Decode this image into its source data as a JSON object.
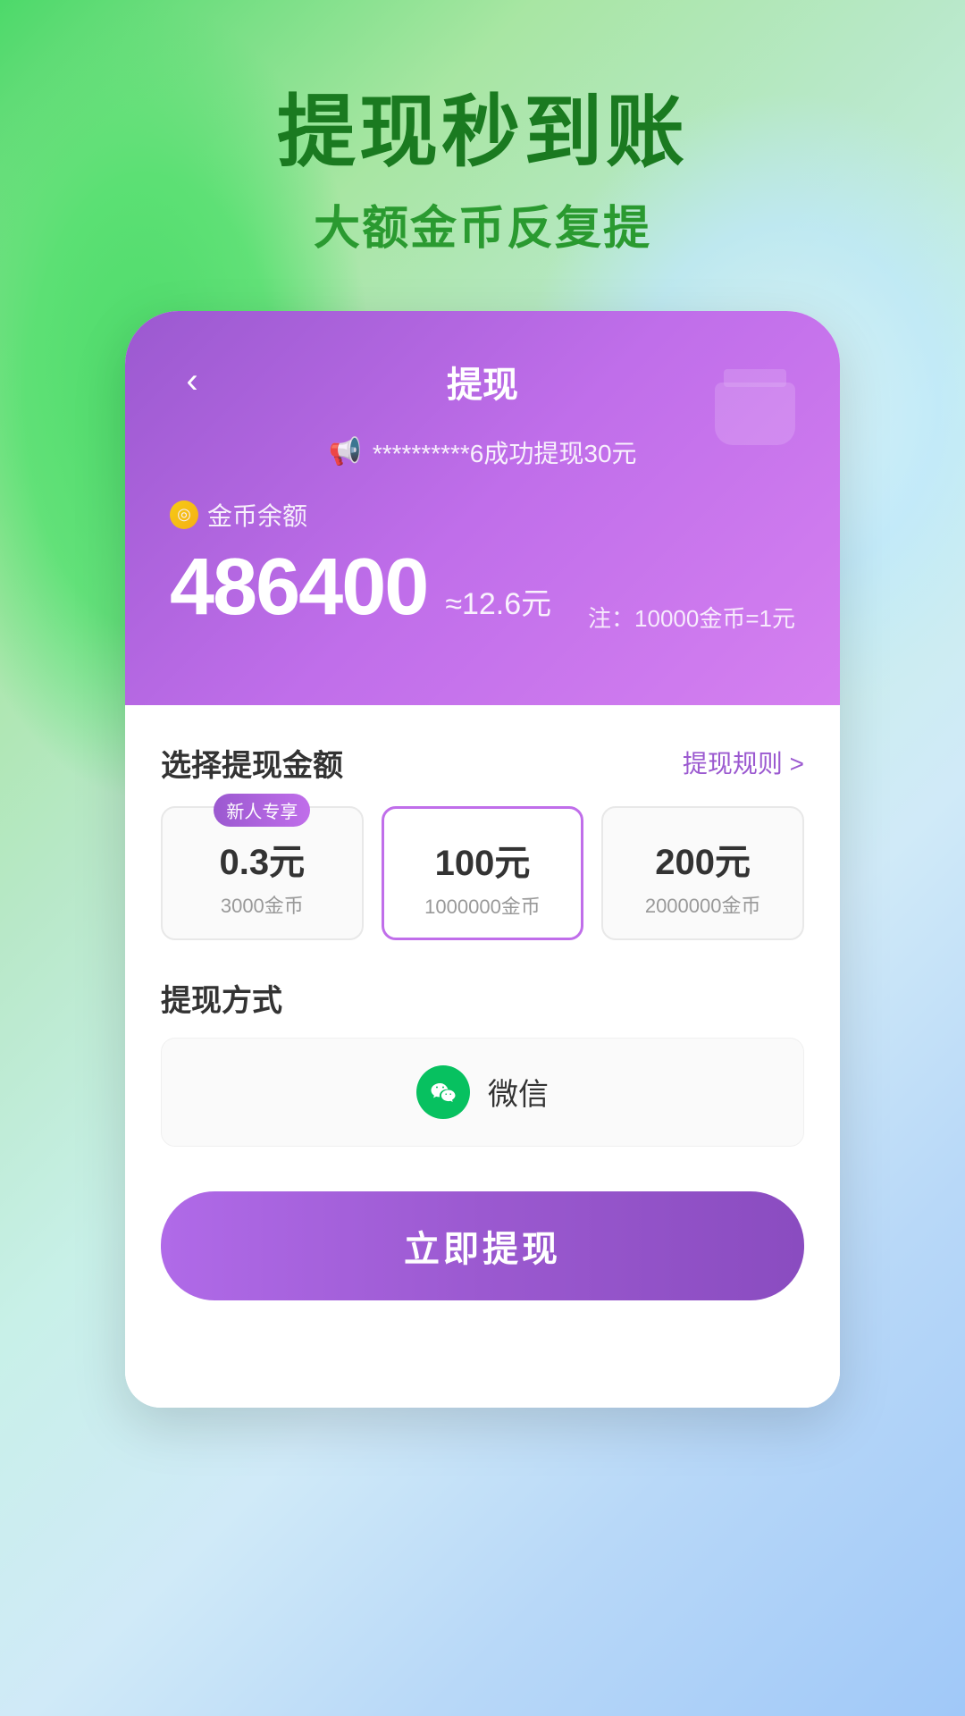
{
  "background": {
    "gradient_desc": "green to light blue gradient background"
  },
  "hero": {
    "main_title": "提现秒到账",
    "sub_title": "大额金币反复提"
  },
  "card": {
    "nav": {
      "back_label": "‹",
      "title": "提现"
    },
    "notification": {
      "speaker_icon": "📢",
      "message": "**********6成功提现30元"
    },
    "balance": {
      "label": "金币余额",
      "amount": "486400",
      "approx": "≈12.6元",
      "note": "注：10000金币=1元"
    },
    "amount_section": {
      "title": "选择提现金额",
      "rules_link": "提现规则 >",
      "options": [
        {
          "badge": "新人专享",
          "amount": "0.3元",
          "coins": "3000金币",
          "selected": false,
          "new_user": true
        },
        {
          "badge": "",
          "amount": "100元",
          "coins": "1000000金币",
          "selected": true,
          "new_user": false
        },
        {
          "badge": "",
          "amount": "200元",
          "coins": "2000000金币",
          "selected": false,
          "new_user": false
        }
      ]
    },
    "method_section": {
      "title": "提现方式",
      "method": {
        "icon": "wechat",
        "label": "微信"
      }
    },
    "submit_button": "立即提现"
  }
}
